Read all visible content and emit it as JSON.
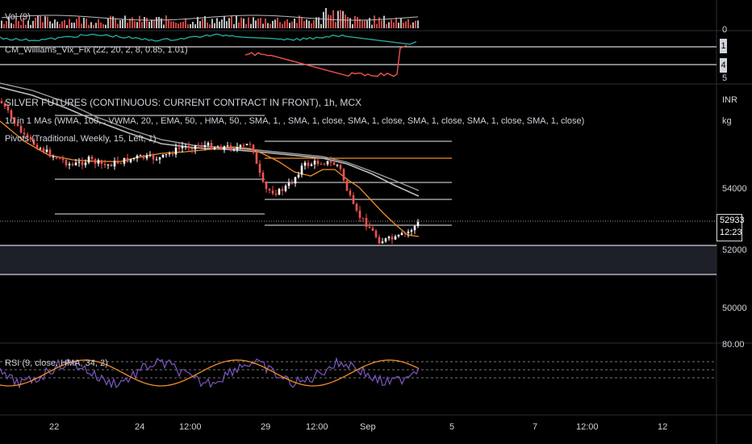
{
  "panes": {
    "volume": {
      "label": "Vol (9)"
    },
    "vix": {
      "label": "CM_Williams_Vix_Fix (22, 20, 2, 8, 0.85, 1.01)",
      "scale_ticks": [
        "0",
        "1",
        "4",
        "5"
      ]
    },
    "main": {
      "title": "SILVER FUTURES (CONTINUOUS: CURRENT CONTRACT IN FRONT), 1h, MCX",
      "mas_label": "10 in 1 MAs (WMA, 100, , VWMA, 20, , EMA, 50, , HMA, 50, , SMA, 1, , SMA, 1, close, SMA, 1, close, SMA, 1, close, SMA, 1, close, SMA, 1, close)",
      "pivots_label": "Pivots (Traditional, Weekly, 15, Left, 1)",
      "currency": "INR",
      "unit": "kg",
      "price_ticks": [
        "54000",
        "52000",
        "50000"
      ],
      "last_price": "52933",
      "countdown": "12:23"
    },
    "rsi": {
      "label": "RSI (9, close, HMA, 34, 2)",
      "top_tick": "80.00"
    }
  },
  "x_axis": {
    "ticks": [
      "22",
      "24",
      "12:00",
      "29",
      "12:00",
      "Sep",
      "5",
      "7",
      "12:00",
      "12"
    ]
  },
  "colors": {
    "background": "#000000",
    "up": "#ffffff",
    "down": "#ef5350",
    "vix_up": "#26a69a",
    "ma_orange": "#f28c28",
    "ma_gray": "#9e9e9e",
    "rsi_line": "#7e57c2",
    "pivot": "#bdbdbd"
  }
}
